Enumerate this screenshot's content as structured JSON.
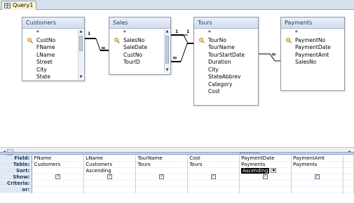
{
  "window": {
    "tab_label": "Query1"
  },
  "tables": [
    {
      "title": "Customers",
      "fields": [
        "*",
        "CustNo",
        "FName",
        "LName",
        "Street",
        "City",
        "State"
      ],
      "primary_key": "CustNo",
      "scrollbar": true
    },
    {
      "title": "Sales",
      "fields": [
        "*",
        "SalesNo",
        "SaleDate",
        "CustNo",
        "TourID"
      ],
      "primary_key": "SalesNo",
      "scrollbar": true
    },
    {
      "title": "Tours",
      "fields": [
        "*",
        "TourNo",
        "TourName",
        "TourStartDate",
        "Duration",
        "City",
        "StateAbbrev",
        "Category",
        "Cost"
      ],
      "primary_key": "TourNo",
      "scrollbar": false
    },
    {
      "title": "Payments",
      "fields": [
        "*",
        "PaymentNo",
        "PaymentDate",
        "PaymentAmt",
        "SalesNo"
      ],
      "primary_key": "PaymentNo",
      "scrollbar": false
    }
  ],
  "relationships": [
    {
      "one_label": "1",
      "many_label": "∞"
    },
    {
      "one_label": "1",
      "many_label": "∞"
    },
    {
      "one_label": "1",
      "many_label": "∞"
    }
  ],
  "grid": {
    "row_labels": {
      "field": "Field:",
      "table": "Table:",
      "sort": "Sort:",
      "show": "Show:",
      "criteria": "Criteria:",
      "or": "or:"
    },
    "columns": [
      {
        "field": "FName",
        "table": "Customers",
        "sort": "",
        "show": true
      },
      {
        "field": "LName",
        "table": "Customers",
        "sort": "Ascending",
        "show": true
      },
      {
        "field": "TourName",
        "table": "Tours",
        "sort": "",
        "show": true
      },
      {
        "field": "Cost",
        "table": "Tours",
        "sort": "",
        "show": true
      },
      {
        "field": "PaymentDate",
        "table": "Payments",
        "sort": "Ascending",
        "show": true,
        "sort_selected": true
      },
      {
        "field": "PaymentAmt",
        "table": "Payments",
        "sort": "",
        "show": true
      },
      {
        "field": "",
        "table": "",
        "sort": "",
        "show": false
      }
    ]
  }
}
